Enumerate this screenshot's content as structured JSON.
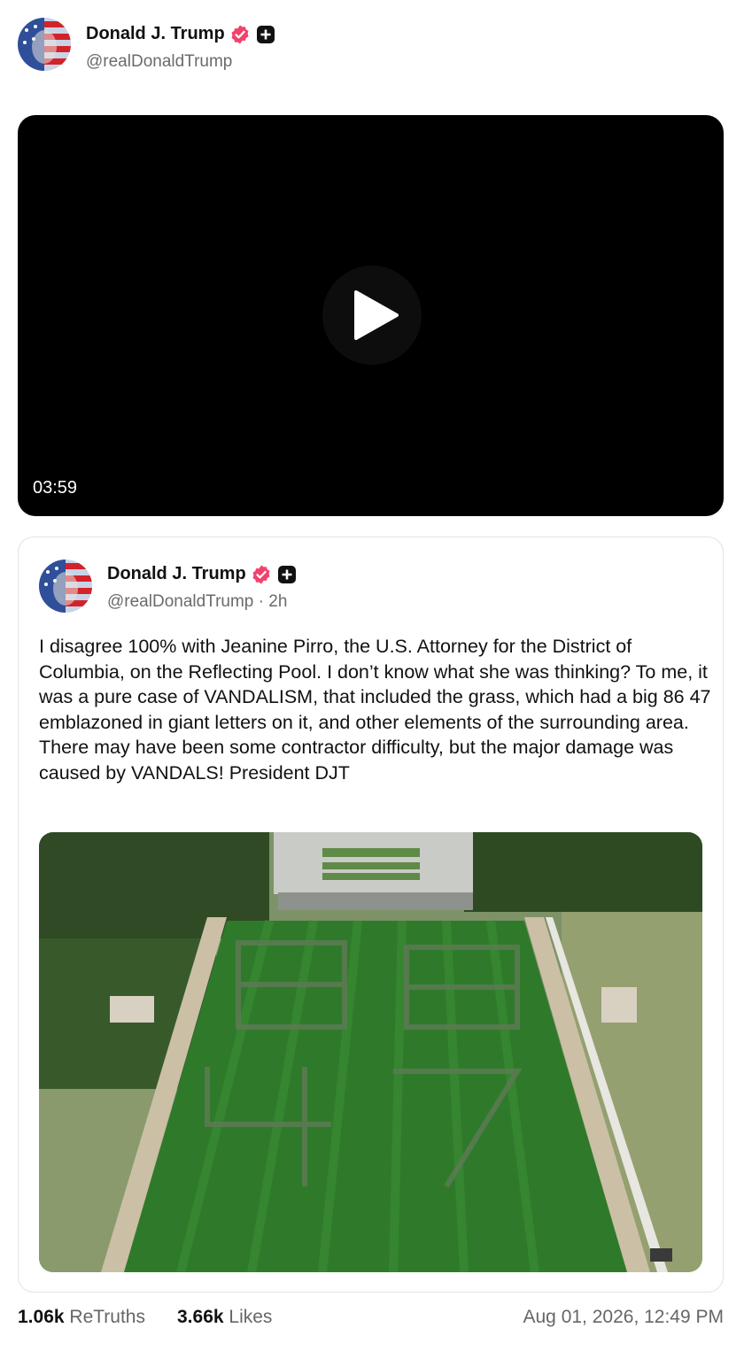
{
  "header": {
    "author_name": "Donald J. Trump",
    "author_handle": "@realDonaldTrump",
    "avatar_icon": "flag-portrait-avatar",
    "verified_icon": "verified-badge-icon",
    "plus_icon": "plus-badge-icon"
  },
  "video": {
    "duration": "03:59",
    "play_icon": "play-icon"
  },
  "quoted_post": {
    "author_name": "Donald J. Trump",
    "author_handle": "@realDonaldTrump · 2h",
    "text": "I disagree 100% with Jeanine Pirro, the U.S. Attorney for the District of Columbia, on the Reflecting Pool. I don’t know what she was thinking? To me, it was a pure case of VANDALISM, that included the grass, which had a big 86 47 emblazoned in giant letters on it, and other elements of the surrounding area. There may have been some contractor difficulty, but the major damage was caused by VANDALS! President DJT",
    "image": "aerial-photo-of-lawn"
  },
  "footer": {
    "retruths_count": "1.06k",
    "retruths_label": "ReTruths",
    "likes_count": "3.66k",
    "likes_label": "Likes",
    "timestamp": "Aug 01, 2026, 12:49 PM"
  },
  "colors": {
    "verified": "#f0426b",
    "text": "#111111",
    "muted": "#6b6b6b"
  }
}
